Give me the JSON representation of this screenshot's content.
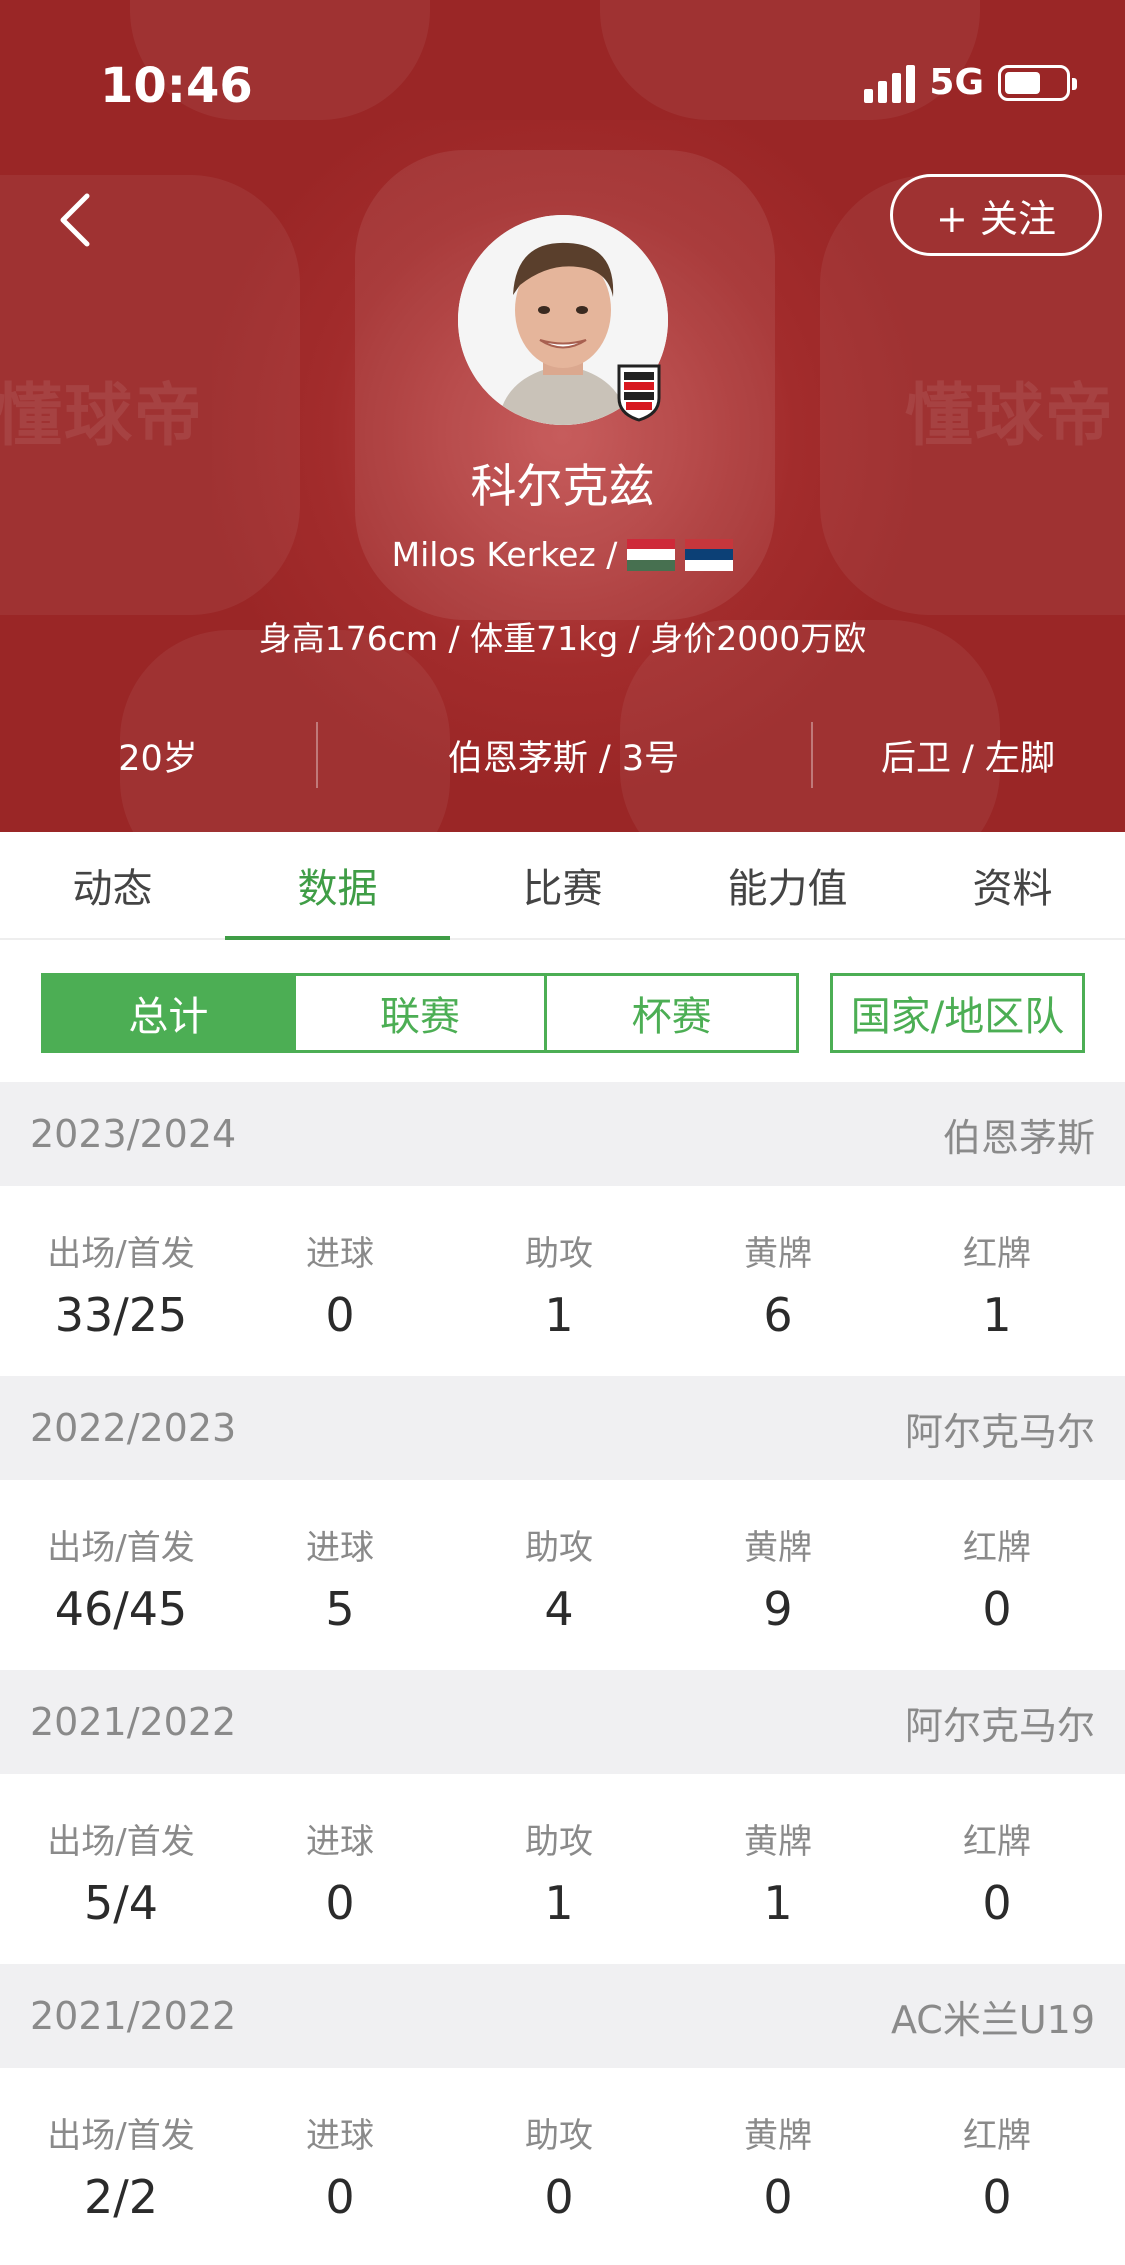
{
  "status_bar": {
    "time": "10:46",
    "network": "5G"
  },
  "header": {
    "follow_label": "+ 关注",
    "watermark": "懂球帝",
    "name_cn": "科尔克兹",
    "name_en": "Milos Kerkez /",
    "physical": "身高176cm / 体重71kg / 身价2000万欧",
    "age": "20岁",
    "club_number": "伯恩茅斯 / 3号",
    "position_foot": "后卫 / 左脚"
  },
  "tabs": [
    {
      "label": "动态",
      "active": false
    },
    {
      "label": "数据",
      "active": true
    },
    {
      "label": "比赛",
      "active": false
    },
    {
      "label": "能力值",
      "active": false
    },
    {
      "label": "资料",
      "active": false
    }
  ],
  "filter": {
    "segments": [
      "总计",
      "联赛",
      "杯赛"
    ],
    "active_segment": "总计",
    "national_label": "国家/地区队"
  },
  "stat_labels": [
    "出场/首发",
    "进球",
    "助攻",
    "黄牌",
    "红牌"
  ],
  "seasons": [
    {
      "year": "2023/2024",
      "team": "伯恩茅斯",
      "values": [
        "33/25",
        "0",
        "1",
        "6",
        "1"
      ]
    },
    {
      "year": "2022/2023",
      "team": "阿尔克马尔",
      "values": [
        "46/45",
        "5",
        "4",
        "9",
        "0"
      ]
    },
    {
      "year": "2021/2022",
      "team": "阿尔克马尔",
      "values": [
        "5/4",
        "0",
        "1",
        "1",
        "0"
      ]
    },
    {
      "year": "2021/2022",
      "team": "AC米兰U19",
      "values": [
        "2/2",
        "0",
        "0",
        "0",
        "0"
      ]
    }
  ],
  "colors": {
    "header_red": "#9a2626",
    "accent_green": "#4cae54"
  }
}
